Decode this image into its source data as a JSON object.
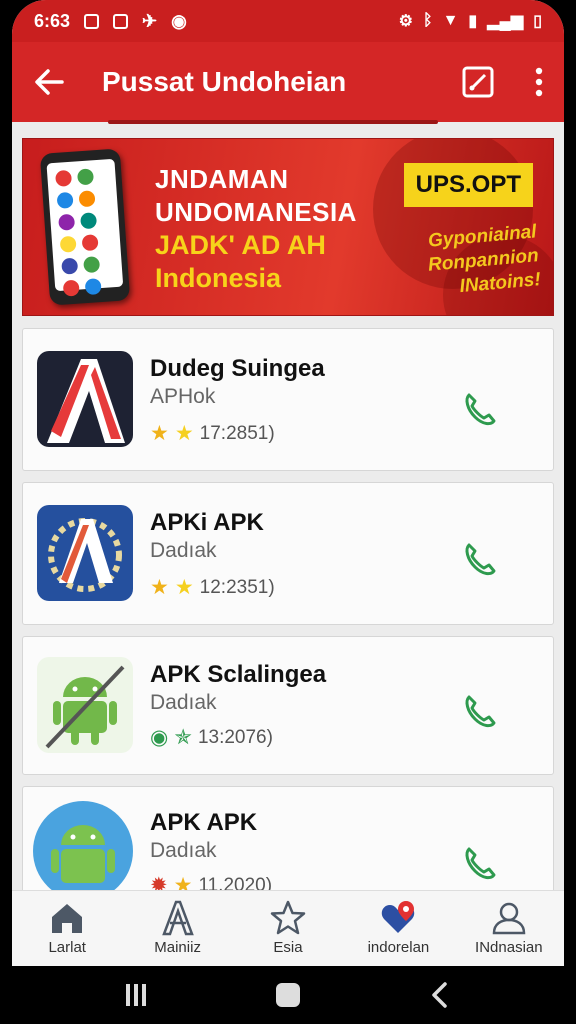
{
  "status_bar": {
    "time": "6:63"
  },
  "app_bar": {
    "title": "Pussat Undoheian"
  },
  "banner": {
    "line1": "JNDAMAN",
    "line2": "UNDOMANESIA",
    "line3": "JADK' AD AH",
    "line4": "Indonesia",
    "badge": "UPS.OPT",
    "promo1": "Gyponiainal",
    "promo2": "Ronpannion",
    "promo3": "INatoins!"
  },
  "apps": [
    {
      "name": "Dudeg Suingea",
      "subtitle": "APHok",
      "rating_text": "17:2851)"
    },
    {
      "name": "APKi APK",
      "subtitle": "Dadıak",
      "rating_text": "12:2351)"
    },
    {
      "name": "APK Sclalingea",
      "subtitle": "Dadıak",
      "rating_text": "13:2076)"
    },
    {
      "name": "APK APK",
      "subtitle": "Dadıak",
      "rating_text": "11.2020)"
    }
  ],
  "bottom_nav": [
    {
      "label": "Larlat",
      "icon": "home-icon"
    },
    {
      "label": "Mainiiz",
      "icon": "a-letter-icon"
    },
    {
      "label": "Esia",
      "icon": "star-icon"
    },
    {
      "label": "indorelan",
      "icon": "heart-location-icon"
    },
    {
      "label": "INdnasian",
      "icon": "person-icon"
    }
  ],
  "colors": {
    "primary": "#d42626",
    "accent_yellow": "#f6d31b",
    "phone_green": "#2e9a4e"
  }
}
